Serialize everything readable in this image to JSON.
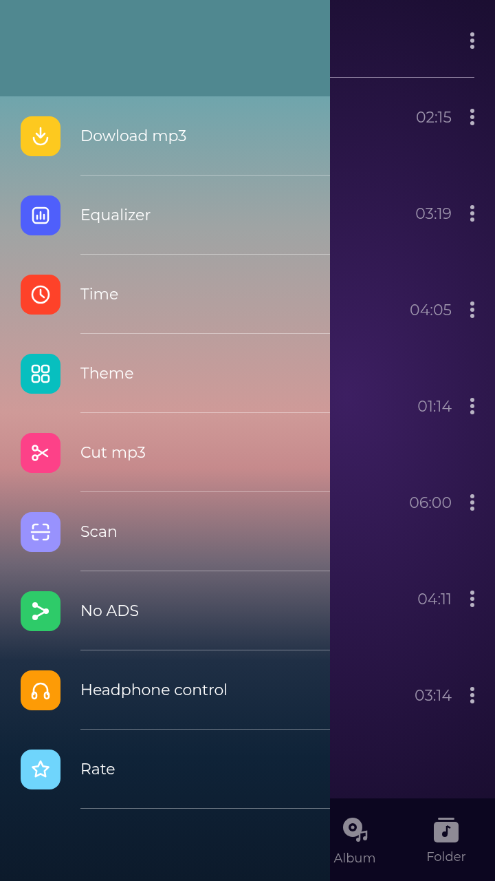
{
  "song_list": {
    "rows": [
      {
        "duration": "02:15"
      },
      {
        "duration": "03:19"
      },
      {
        "duration": "04:05"
      },
      {
        "duration": "01:14"
      },
      {
        "duration": "06:00"
      },
      {
        "duration": "04:11"
      },
      {
        "duration": "03:14"
      }
    ]
  },
  "bottom_nav": [
    {
      "label": "Album"
    },
    {
      "label": "Folder"
    }
  ],
  "drawer": {
    "items": [
      {
        "label": "Dowload mp3",
        "color": "#fdc91f"
      },
      {
        "label": "Equalizer",
        "color": "#4f5ffb"
      },
      {
        "label": "Time",
        "color": "#fe4229"
      },
      {
        "label": "Theme",
        "color": "#07bfbf"
      },
      {
        "label": "Cut mp3",
        "color": "#fd4188"
      },
      {
        "label": "Scan",
        "color": "#9892fd"
      },
      {
        "label": "No ADS",
        "color": "#2ecb69"
      },
      {
        "label": "Headphone control",
        "color": "#fd9b06"
      },
      {
        "label": "Rate",
        "color": "#6fd5fc"
      }
    ]
  }
}
